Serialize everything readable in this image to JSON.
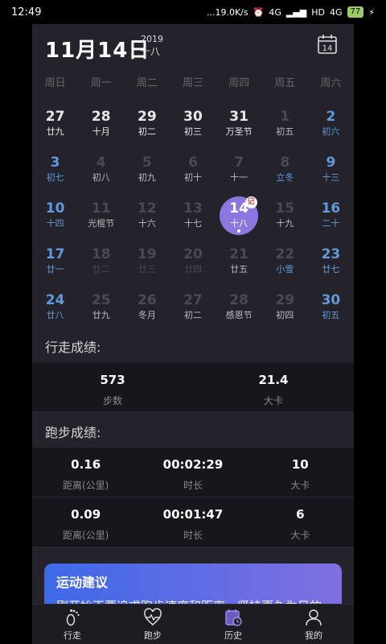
{
  "status_bar": {
    "time": "12:49",
    "network": "...19.0K/s",
    "signal": "4G",
    "signal2": "4G",
    "hd": "HD",
    "battery": "77"
  },
  "header": {
    "date": "11月14日",
    "year": "2019",
    "lunar": "十八",
    "calendar_icon_day": "14"
  },
  "weekdays": [
    "周日",
    "周一",
    "周二",
    "周三",
    "周四",
    "周五",
    "周六"
  ],
  "calendar": [
    {
      "n": "27",
      "s": "廿九",
      "c": "cur"
    },
    {
      "n": "28",
      "s": "十月",
      "c": "cur"
    },
    {
      "n": "29",
      "s": "初二",
      "c": "cur"
    },
    {
      "n": "30",
      "s": "初三",
      "c": "cur"
    },
    {
      "n": "31",
      "s": "万圣节",
      "c": "cur"
    },
    {
      "n": "1",
      "s": "初五",
      "c": "dim sub-lit"
    },
    {
      "n": "2",
      "s": "初六",
      "c": "wk"
    },
    {
      "n": "3",
      "s": "初七",
      "c": "wk"
    },
    {
      "n": "4",
      "s": "初八",
      "c": "dim sub-lit"
    },
    {
      "n": "5",
      "s": "初九",
      "c": "dim sub-lit"
    },
    {
      "n": "6",
      "s": "初十",
      "c": "dim sub-lit"
    },
    {
      "n": "7",
      "s": "十一",
      "c": "dim sub-lit"
    },
    {
      "n": "8",
      "s": "立冬",
      "c": "dim sub-blue"
    },
    {
      "n": "9",
      "s": "十三",
      "c": "wk"
    },
    {
      "n": "10",
      "s": "十四",
      "c": "wk"
    },
    {
      "n": "11",
      "s": "光棍节",
      "c": "dim sub-lit"
    },
    {
      "n": "12",
      "s": "十六",
      "c": "dim sub-lit"
    },
    {
      "n": "13",
      "s": "十七",
      "c": "dim sub-lit"
    },
    {
      "n": "14",
      "s": "十八",
      "c": "sel"
    },
    {
      "n": "15",
      "s": "十九",
      "c": "dim sub-lit"
    },
    {
      "n": "16",
      "s": "二十",
      "c": "wk"
    },
    {
      "n": "17",
      "s": "廿一",
      "c": "wk"
    },
    {
      "n": "18",
      "s": "廿二",
      "c": "dim"
    },
    {
      "n": "19",
      "s": "廿三",
      "c": "dim"
    },
    {
      "n": "20",
      "s": "廿四",
      "c": "dim"
    },
    {
      "n": "21",
      "s": "廿五",
      "c": "dim sub-lit"
    },
    {
      "n": "22",
      "s": "小雪",
      "c": "dim sub-blue"
    },
    {
      "n": "23",
      "s": "廿七",
      "c": "wk"
    },
    {
      "n": "24",
      "s": "廿八",
      "c": "wk"
    },
    {
      "n": "25",
      "s": "廿九",
      "c": "dim sub-lit"
    },
    {
      "n": "26",
      "s": "冬月",
      "c": "dim sub-lit"
    },
    {
      "n": "27",
      "s": "初二",
      "c": "dim sub-lit"
    },
    {
      "n": "28",
      "s": "感恩节",
      "c": "dim sub-lit"
    },
    {
      "n": "29",
      "s": "初四",
      "c": "dim sub-lit"
    },
    {
      "n": "30",
      "s": "初五",
      "c": "wk"
    }
  ],
  "selected_mark": "记",
  "walk": {
    "title": "行走成绩:",
    "stats": [
      {
        "value": "573",
        "label": "步数"
      },
      {
        "value": "21.4",
        "label": "大卡"
      }
    ]
  },
  "run": {
    "title": "跑步成绩:",
    "rows": [
      [
        {
          "value": "0.16",
          "label": "距离(公里)"
        },
        {
          "value": "00:02:29",
          "label": "时长"
        },
        {
          "value": "10",
          "label": "大卡"
        }
      ],
      [
        {
          "value": "0.09",
          "label": "距离(公里)"
        },
        {
          "value": "00:01:47",
          "label": "时长"
        },
        {
          "value": "6",
          "label": "大卡"
        }
      ]
    ]
  },
  "advice": {
    "title": "运动建议",
    "body": "刚开始不要追求跑步速度和距离，坚持更久为目的"
  },
  "tabs": [
    {
      "label": "行走",
      "icon": "footprint-icon"
    },
    {
      "label": "跑步",
      "icon": "heart-pulse-icon"
    },
    {
      "label": "历史",
      "icon": "history-calendar-icon"
    },
    {
      "label": "我的",
      "icon": "person-icon"
    }
  ]
}
